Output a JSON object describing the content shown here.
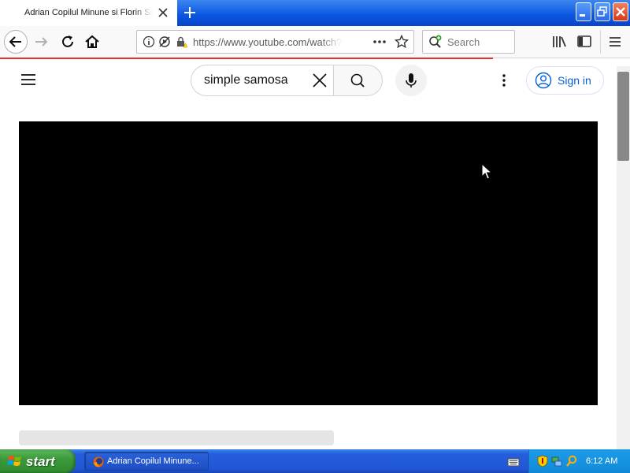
{
  "browser": {
    "tab_title": "Adrian Copilul Minune si Florin Salam",
    "url": "https://www.youtube.com/watch?v=",
    "search_placeholder": "Search"
  },
  "youtube": {
    "search_query": "simple samosa",
    "signin_label": "Sign in"
  },
  "taskbar": {
    "start_label": "start",
    "task_label": "Adrian Copilul Minune...",
    "clock": "6:12 AM"
  },
  "colors": {
    "progress": "#e5302b",
    "signin_blue": "#065fd4",
    "taskbar_blue": "#245edb",
    "start_green": "#3c9a3c"
  }
}
